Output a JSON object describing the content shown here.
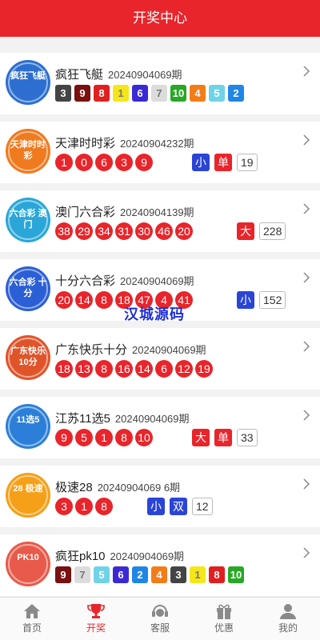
{
  "header": {
    "title": "开奖中心"
  },
  "watermark": "汉城源码",
  "lotteries": [
    {
      "name": "疯狂飞艇",
      "issue": "20240904069期",
      "logo_text": "疯狂飞艇",
      "logo_color": "#2c6fd1",
      "pk_numbers": [
        {
          "n": "3",
          "color": "#444444"
        },
        {
          "n": "9",
          "color": "#7a1010"
        },
        {
          "n": "8",
          "color": "#e02020"
        },
        {
          "n": "1",
          "color": "#f5e61a",
          "light": true
        },
        {
          "n": "6",
          "color": "#3a2ad6"
        },
        {
          "n": "7",
          "color": "#dcdcdc",
          "light": true
        },
        {
          "n": "10",
          "color": "#27a826"
        },
        {
          "n": "4",
          "color": "#f27d18"
        },
        {
          "n": "5",
          "color": "#6fd3e8"
        },
        {
          "n": "2",
          "color": "#1f86e6"
        }
      ]
    },
    {
      "name": "天津时时彩",
      "issue": "20240904232期",
      "logo_text": "天津时时彩",
      "logo_color": "#f07a1e",
      "numbers": [
        "1",
        "0",
        "6",
        "3",
        "9"
      ],
      "tags": [
        {
          "t": "小",
          "style": "blue"
        },
        {
          "t": "单",
          "style": "red"
        },
        {
          "t": "19",
          "style": "box"
        }
      ]
    },
    {
      "name": "澳门六合彩",
      "issue": "20240904139期",
      "logo_text": "六合彩 澳门",
      "logo_color": "#2aa7d8",
      "numbers": [
        "38",
        "29",
        "34",
        "31",
        "30",
        "46",
        "20"
      ],
      "tags": [
        {
          "t": "大",
          "style": "red"
        },
        {
          "t": "228",
          "style": "box"
        }
      ]
    },
    {
      "name": "十分六合彩",
      "issue": "20240904069期",
      "logo_text": "六合彩 十分",
      "logo_color": "#2a5fd6",
      "numbers": [
        "20",
        "14",
        "8",
        "18",
        "47",
        "4",
        "41"
      ],
      "tags": [
        {
          "t": "小",
          "style": "blue"
        },
        {
          "t": "152",
          "style": "box"
        }
      ]
    },
    {
      "name": "广东快乐十分",
      "issue": "20240904069期",
      "logo_text": "广东快乐10分",
      "logo_color": "#e0542a",
      "numbers": [
        "18",
        "13",
        "8",
        "16",
        "14",
        "6",
        "12",
        "19"
      ],
      "tags": []
    },
    {
      "name": "江苏11选5",
      "issue": "20240904069期",
      "logo_text": "11选5",
      "logo_color": "#2c7fd8",
      "numbers": [
        "9",
        "5",
        "1",
        "8",
        "10"
      ],
      "tags": [
        {
          "t": "大",
          "style": "red"
        },
        {
          "t": "单",
          "style": "red"
        },
        {
          "t": "33",
          "style": "box"
        }
      ]
    },
    {
      "name": "极速28",
      "issue": "20240904069 6期",
      "logo_text": "28 极速",
      "logo_color": "#f5a018",
      "numbers": [
        "3",
        "1",
        "8"
      ],
      "tags": [
        {
          "t": "小",
          "style": "blue"
        },
        {
          "t": "双",
          "style": "blue"
        },
        {
          "t": "12",
          "style": "box"
        }
      ]
    },
    {
      "name": "疯狂pk10",
      "issue": "20240904069期",
      "logo_text": "PK10",
      "logo_color": "#e85a4a",
      "pk_numbers": [
        {
          "n": "9",
          "color": "#7a1010"
        },
        {
          "n": "7",
          "color": "#dcdcdc",
          "light": true
        },
        {
          "n": "5",
          "color": "#6fd3e8"
        },
        {
          "n": "6",
          "color": "#3a2ad6"
        },
        {
          "n": "2",
          "color": "#1f86e6"
        },
        {
          "n": "4",
          "color": "#f27d18"
        },
        {
          "n": "3",
          "color": "#444444"
        },
        {
          "n": "1",
          "color": "#f5e61a",
          "light": true
        },
        {
          "n": "8",
          "color": "#e02020"
        },
        {
          "n": "10",
          "color": "#27a826"
        }
      ]
    }
  ],
  "tabbar": [
    {
      "label": "首页",
      "icon": "home-icon"
    },
    {
      "label": "开奖",
      "icon": "trophy-icon",
      "active": true
    },
    {
      "label": "客服",
      "icon": "headset-icon"
    },
    {
      "label": "优惠",
      "icon": "gift-icon"
    },
    {
      "label": "我的",
      "icon": "user-icon"
    }
  ]
}
